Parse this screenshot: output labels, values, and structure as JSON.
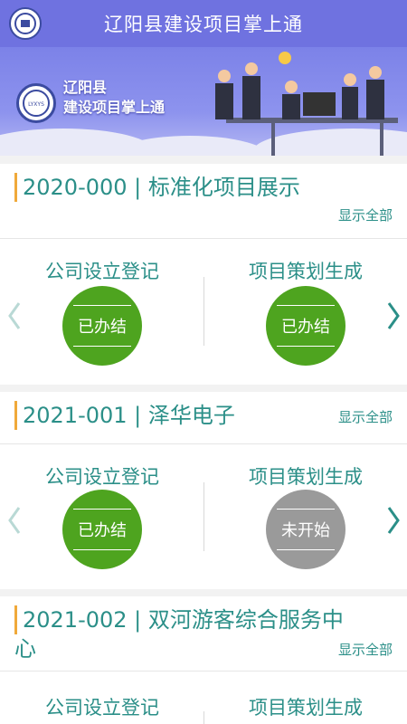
{
  "header": {
    "title": "辽阳县建设项目掌上通",
    "logo_text": "LYXYS"
  },
  "banner": {
    "line1": "辽阳县",
    "line2": "建设项目掌上通"
  },
  "projects": [
    {
      "title": "2020-000 | 标准化项目展示",
      "show_all": "显示全部",
      "steps": [
        {
          "label": "公司设立登记",
          "status": "已办结"
        },
        {
          "label": "项目策划生成",
          "status": "已办结"
        }
      ]
    },
    {
      "title": "2021-001 | 泽华电子",
      "show_all": "显示全部",
      "steps": [
        {
          "label": "公司设立登记",
          "status": "已办结"
        },
        {
          "label": "项目策划生成",
          "status": "未开始"
        }
      ]
    },
    {
      "title_line1": "2021-002 | 双河游客综合服务中",
      "title_line2": "心",
      "show_all": "显示全部",
      "steps": [
        {
          "label": "公司设立登记"
        },
        {
          "label": "项目策划生成"
        }
      ]
    }
  ],
  "colors": {
    "header": "#6f72e0",
    "accent": "#2b8f88",
    "done": "#4ea41f",
    "pending": "#9a9a9a",
    "bar": "#f0a93a"
  },
  "icons": {
    "prev": "chevron-left-icon",
    "next": "chevron-right-icon"
  }
}
